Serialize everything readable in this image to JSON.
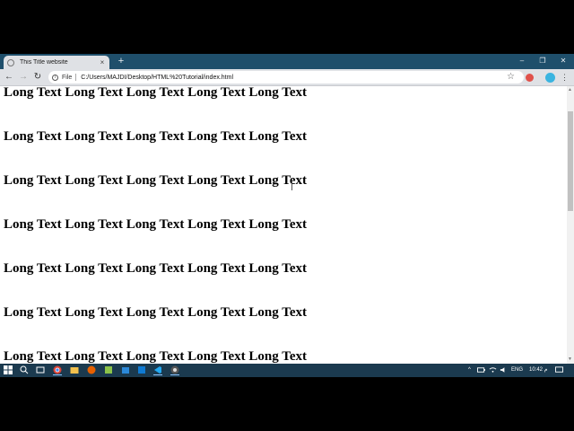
{
  "browser": {
    "tab": {
      "title": "This Title website",
      "close_glyph": "×"
    },
    "new_tab_glyph": "+",
    "window_controls": {
      "minimize": "–",
      "restore": "❐",
      "close": "✕"
    },
    "nav": {
      "back": "←",
      "forward": "→",
      "reload": "↻"
    },
    "omnibox": {
      "info_glyph": "i",
      "scheme_label": "File",
      "url": "C:/Users/MAJDI/Desktop/HTML%20Tutorial/index.html"
    },
    "star_glyph": "☆",
    "menu_glyph": "⋮"
  },
  "page": {
    "headings": [
      "Long Text Long Text Long Text Long Text Long Text",
      "Long Text Long Text Long Text Long Text Long Text",
      "Long Text Long Text Long Text Long Text Long Text",
      "Long Text Long Text Long Text Long Text Long Text",
      "Long Text Long Text Long Text Long Text Long Text",
      "Long Text Long Text Long Text Long Text Long Text",
      "Long Text Long Text Long Text Long Text Long Text"
    ]
  },
  "taskbar": {
    "apps": [
      "windows-start-icon",
      "search-icon",
      "task-view-icon",
      "chrome-icon",
      "file-explorer-icon",
      "firefox-icon",
      "app-icon",
      "store-icon",
      "outlook-icon",
      "vscode-icon",
      "chrome-icon"
    ],
    "language": "ENG",
    "time": "10:42 م",
    "caret_glyph": "^"
  },
  "colors": {
    "tabstrip": "#1f4f6b",
    "toolbar": "#dfe1e5",
    "taskbar": "#1b3a4f",
    "profile": "#3ab4e0",
    "extension": "#e0514b"
  }
}
